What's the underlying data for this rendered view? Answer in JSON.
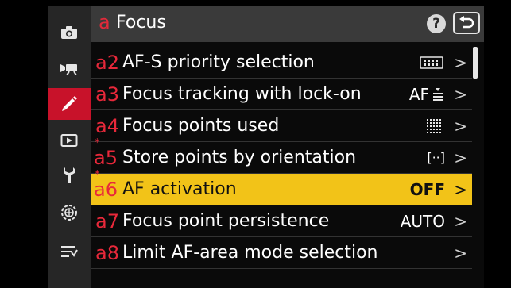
{
  "header": {
    "menu_letter": "a",
    "title": "Focus",
    "help_label": "?",
    "back_icon": "return-arrow-icon"
  },
  "sidebar": {
    "items": [
      {
        "icon": "camera-icon",
        "active": false
      },
      {
        "icon": "movie-camera-icon",
        "active": false
      },
      {
        "icon": "pencil-icon",
        "active": true
      },
      {
        "icon": "playback-icon",
        "active": false
      },
      {
        "icon": "wrench-icon",
        "active": false
      },
      {
        "icon": "network-icon",
        "active": false
      },
      {
        "icon": "my-menu-icon",
        "active": false
      }
    ]
  },
  "menu": {
    "items": [
      {
        "code": "a2",
        "label": "AF-S priority selection",
        "value": "",
        "value_icon": "af-s-priority-icon",
        "starred": false,
        "selected": false
      },
      {
        "code": "a3",
        "label": "Focus tracking with lock-on",
        "value": "AF",
        "value_icon": "lock-on-level-icon",
        "starred": false,
        "selected": false
      },
      {
        "code": "a4",
        "label": "Focus points used",
        "value": "",
        "value_icon": "focus-points-grid-icon",
        "starred": false,
        "selected": false
      },
      {
        "code": "a5",
        "label": "Store points by orientation",
        "value": "[··]",
        "value_icon": "",
        "starred": true,
        "selected": false
      },
      {
        "code": "a6",
        "label": "AF activation",
        "value": "OFF",
        "value_icon": "",
        "starred": true,
        "selected": true
      },
      {
        "code": "a7",
        "label": "Focus point persistence",
        "value": "AUTO",
        "value_icon": "",
        "starred": false,
        "selected": false
      },
      {
        "code": "a8",
        "label": "Limit AF-area mode selection",
        "value": "",
        "value_icon": "",
        "starred": false,
        "selected": false
      }
    ],
    "chevron": ">",
    "star_glyph": "*"
  },
  "colors": {
    "accent_red": "#e8283a",
    "selected_row": "#f2c318",
    "header_bg": "#3a3a3a",
    "sidebar_bg": "#262626",
    "active_tab": "#c8122a"
  }
}
